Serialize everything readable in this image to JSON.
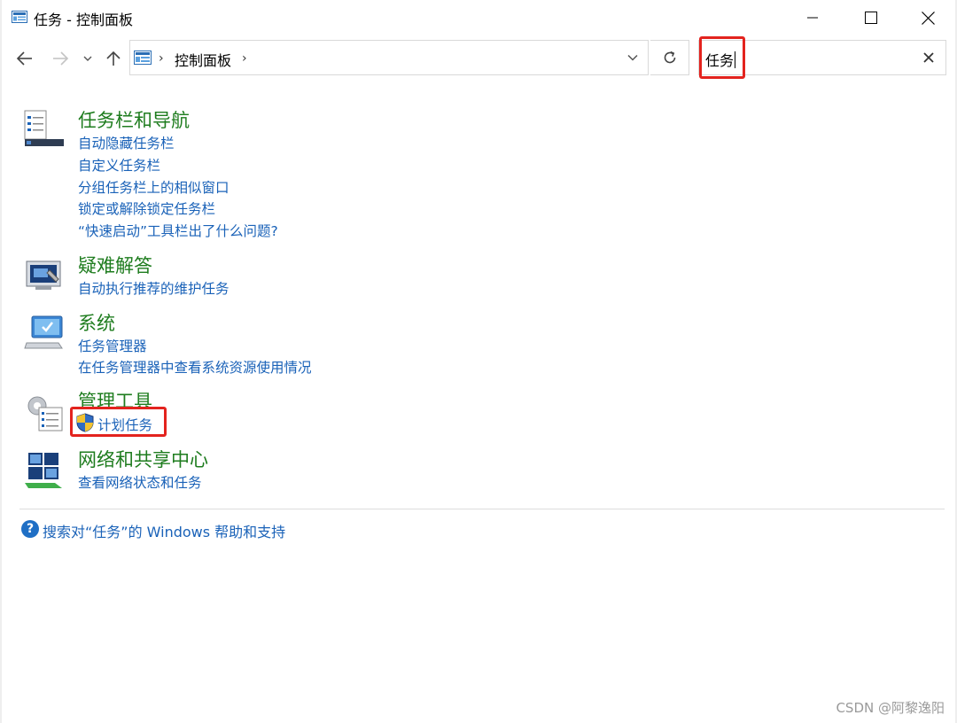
{
  "window": {
    "title": "任务 - 控制面板",
    "controls": [
      "minimize",
      "maximize",
      "close"
    ]
  },
  "navigation": {
    "back_icon": "arrow-left-icon",
    "forward_icon": "arrow-right-icon",
    "recent_icon": "chevron-down-icon",
    "up_icon": "arrow-up-icon",
    "breadcrumb": [
      "控制面板"
    ],
    "refresh_icon": "refresh-icon"
  },
  "search": {
    "value": "任务",
    "clear_icon": "close-icon"
  },
  "results": [
    {
      "title": "任务栏和导航",
      "icon": "taskbar-icon",
      "links": [
        "自动隐藏任务栏",
        "自定义任务栏",
        "分组任务栏上的相似窗口",
        "锁定或解除锁定任务栏",
        "“快速启动”工具栏出了什么问题?"
      ]
    },
    {
      "title": "疑难解答",
      "icon": "troubleshooting-icon",
      "links": [
        "自动执行推荐的维护任务"
      ]
    },
    {
      "title": "系统",
      "icon": "system-computer-icon",
      "links": [
        "任务管理器",
        "在任务管理器中查看系统资源使用情况"
      ]
    },
    {
      "title": "管理工具",
      "icon": "admin-tools-icon",
      "links": [
        "计划任务"
      ]
    },
    {
      "title": "网络和共享中心",
      "icon": "network-icon",
      "links": [
        "查看网络状态和任务"
      ]
    }
  ],
  "help": {
    "icon": "help-icon",
    "text": "搜索对“任务”的 Windows 帮助和支持"
  },
  "watermark": "CSDN @阿黎逸阳",
  "colors": {
    "group_title": "#1e7c1e",
    "link": "#1a62b8",
    "highlight": "#e3231e"
  }
}
